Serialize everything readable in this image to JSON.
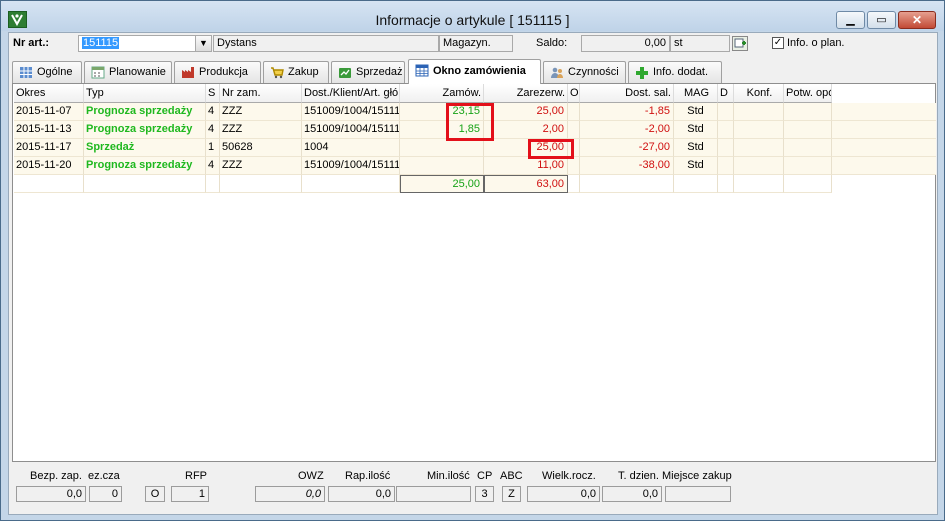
{
  "window": {
    "title": "Informacje o artykule [ 151115 ]"
  },
  "header": {
    "nr_art_label": "Nr art.:",
    "nr_art_value": "151115",
    "description": "Dystans",
    "magazyn_label": "Magazyn.",
    "saldo_label": "Saldo:",
    "saldo_value": "0,00",
    "unit": "st",
    "info_plan_label": "Info. o plan.",
    "info_plan_checked": true
  },
  "tabs": [
    {
      "label": "Ogólne",
      "icon": "grid-icon"
    },
    {
      "label": "Planowanie",
      "icon": "calendar-icon"
    },
    {
      "label": "Produkcja",
      "icon": "factory-icon"
    },
    {
      "label": "Zakup",
      "icon": "cart-icon"
    },
    {
      "label": "Sprzedaż",
      "icon": "sales-icon"
    },
    {
      "label": "Okno zamówienia",
      "icon": "table-icon",
      "active": true
    },
    {
      "label": "Czynności",
      "icon": "people-icon"
    },
    {
      "label": "Info. dodat.",
      "icon": "plus-icon"
    }
  ],
  "grid": {
    "columns": [
      "Okres",
      "Typ",
      "S",
      "Nr zam.",
      "Dost./Klient/Art. głó",
      "Zamów.",
      "Zarezerw.",
      "O",
      "Dost. sal.",
      "MAG",
      "D",
      "Konf.",
      "Potw. opó"
    ],
    "rows": [
      {
        "okres": "2015-11-07",
        "typ": "Prognoza sprzedaży",
        "s": "4",
        "nr_zam": "ZZZ",
        "dost": "151009/1004/15111",
        "zamow": "23,15",
        "zarezerw": "25,00",
        "o": "",
        "dost_sal": "-1,85",
        "mag": "Std",
        "d": "",
        "konf": "",
        "potw": ""
      },
      {
        "okres": "2015-11-13",
        "typ": "Prognoza sprzedaży",
        "s": "4",
        "nr_zam": "ZZZ",
        "dost": "151009/1004/15111",
        "zamow": "1,85",
        "zarezerw": "2,00",
        "o": "",
        "dost_sal": "-2,00",
        "mag": "Std",
        "d": "",
        "konf": "",
        "potw": ""
      },
      {
        "okres": "2015-11-17",
        "typ": "Sprzedaż",
        "s": "1",
        "nr_zam": "50628",
        "dost": "1004",
        "zamow": "",
        "zarezerw": "25,00",
        "o": "",
        "dost_sal": "-27,00",
        "mag": "Std",
        "d": "",
        "konf": "",
        "potw": ""
      },
      {
        "okres": "2015-11-20",
        "typ": "Prognoza sprzedaży",
        "s": "4",
        "nr_zam": "ZZZ",
        "dost": "151009/1004/15111",
        "zamow": "",
        "zarezerw": "11,00",
        "o": "",
        "dost_sal": "-38,00",
        "mag": "Std",
        "d": "",
        "konf": "",
        "potw": ""
      }
    ],
    "totals": {
      "zamow": "25,00",
      "zarezerw": "63,00"
    }
  },
  "bottom": {
    "labels": [
      "Bezp. zap.",
      "ez.cza",
      "RFP",
      "OWZ",
      "Rap.ilość",
      "Min.ilość",
      "CP",
      "ABC",
      "Wielk.rocz.",
      "T. dzien.",
      "Miejsce zakup"
    ],
    "values": {
      "bezp_zap": "0,0",
      "ez_cza": "0",
      "o_flag": "O",
      "rfp": "1",
      "owz": "0,0",
      "rap_ilosc": "0,0",
      "min_ilosc": "",
      "cp": "3",
      "abc": "Z",
      "wielk_rocz": "0,0",
      "t_dzien": "0,0",
      "miejsce_zakup": ""
    }
  },
  "colors": {
    "forecast_text": "#1fb81f",
    "quantity_green": "#17a317",
    "negative_red": "#d01010",
    "highlight": "#e3101a",
    "row_bg": "#fdf9ec"
  }
}
